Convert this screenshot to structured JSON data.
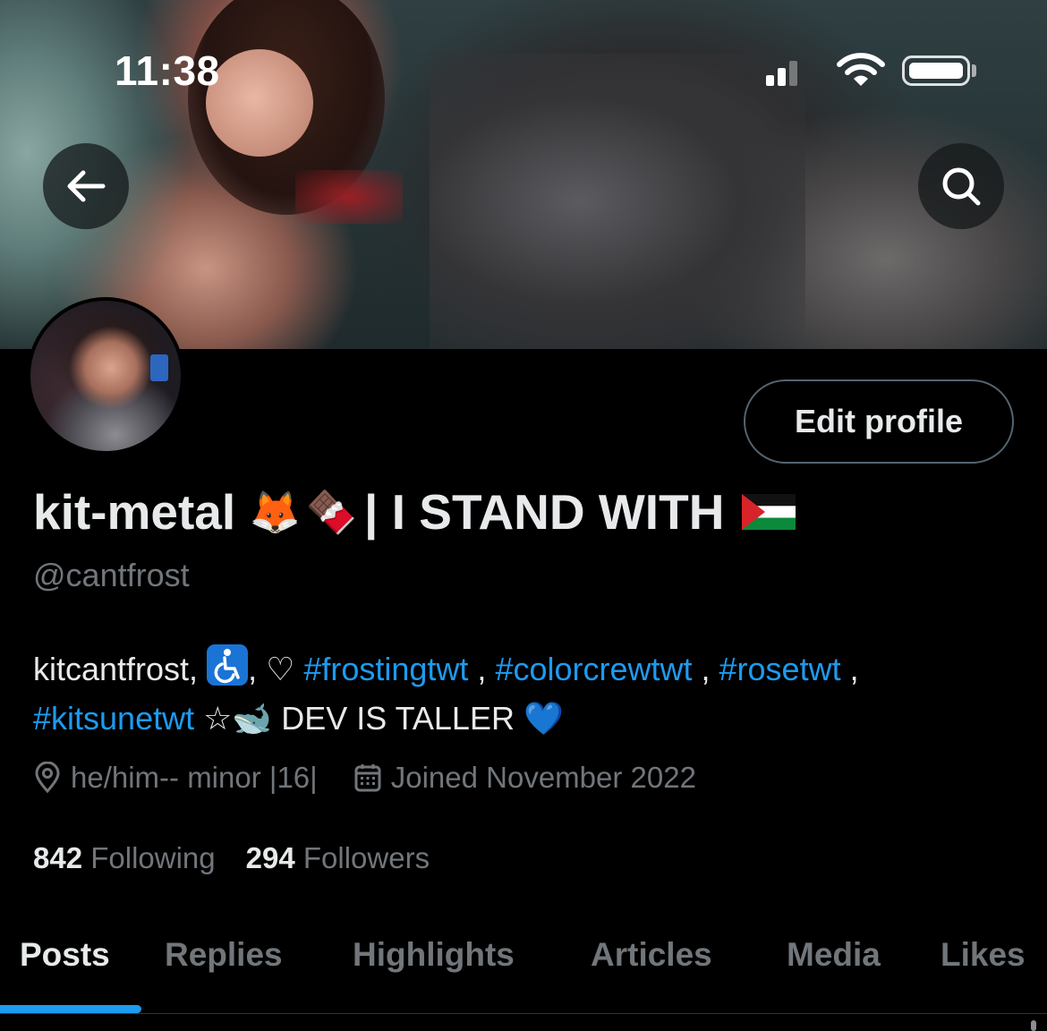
{
  "status_bar": {
    "time": "11:38",
    "icons": [
      "cellular-signal-icon",
      "wifi-icon",
      "battery-icon"
    ]
  },
  "header": {
    "back_icon": "arrow-left-icon",
    "search_icon": "search-icon"
  },
  "profile": {
    "edit_button_label": "Edit profile",
    "display_name": {
      "text_before": "kit-metal ",
      "emojis": [
        "🦊",
        "🍫"
      ],
      "text_after": "| I STAND WITH ",
      "flag_icon": "palestine-flag-icon"
    },
    "handle": "@cantfrost",
    "bio": {
      "part1": "kitcantfrost, ",
      "accessibility_icon": "wheelchair-symbol-icon",
      "part2": ", ♡ ",
      "tag1": "#frostingtwt",
      "sep1": " , ",
      "tag2": "#colorcrewtwt",
      "sep2": " , ",
      "tag3": "#rosetwt",
      "sep3": " , ",
      "tag4": "#kitsunetwt",
      "part3": " ☆🐋 DEV IS TALLER ",
      "heart": "💙"
    },
    "location": "he/him-- minor |16|",
    "joined": "Joined November 2022",
    "following_count": "842",
    "following_label": "Following",
    "followers_count": "294",
    "followers_label": "Followers"
  },
  "tabs": [
    {
      "label": "Posts",
      "active": true
    },
    {
      "label": "Replies",
      "active": false
    },
    {
      "label": "Highlights",
      "active": false
    },
    {
      "label": "Articles",
      "active": false
    },
    {
      "label": "Media",
      "active": false
    },
    {
      "label": "Likes",
      "active": false
    }
  ],
  "colors": {
    "background": "#000000",
    "text_primary": "#e7e9ea",
    "text_secondary": "#71767b",
    "accent": "#1d9bf0",
    "border": "#536471"
  }
}
